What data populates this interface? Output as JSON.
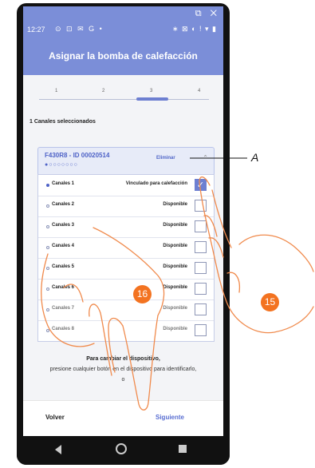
{
  "statusbar": {
    "time": "12:27",
    "icons_left": "⊙ ⊡ ✉ G •",
    "icons_right": "∗ ⊠ ◐ ! ▾ ▮",
    "top_icons": "⧉ ✕"
  },
  "header": {
    "title": "Asignar la bomba de calefacción"
  },
  "stepper": {
    "steps": [
      "1",
      "2",
      "3",
      "4"
    ],
    "active_step": 3
  },
  "selection": {
    "count_label": "1 Canales seleccionados"
  },
  "device": {
    "name": "F430R8 - ID 00020514",
    "dots": "●○○○○○○○",
    "remove_label": "Eliminar",
    "chevron": "⌃"
  },
  "channels": [
    {
      "name": "Canales 1",
      "status": "Vinculado para calefacción",
      "checked": true
    },
    {
      "name": "Canales 2",
      "status": "Disponible",
      "checked": false
    },
    {
      "name": "Canales 3",
      "status": "Disponible",
      "checked": false
    },
    {
      "name": "Canales 4",
      "status": "Disponible",
      "checked": false
    },
    {
      "name": "Canales 5",
      "status": "Disponible",
      "checked": false
    },
    {
      "name": "Canales 6",
      "status": "Disponible",
      "checked": false
    },
    {
      "name": "Canales 7",
      "status": "Disponible",
      "checked": false
    },
    {
      "name": "Canales 8",
      "status": "Disponible",
      "checked": false
    }
  ],
  "info": {
    "line1": "Para cambiar el dispositivo,",
    "line2": "presione cualquier botón en el dispositivo para identificarlo,",
    "line3": "o"
  },
  "footer": {
    "back_label": "Volver",
    "next_label": "Siguiente"
  },
  "annotations": {
    "callout_a": "A",
    "callout_15": "15",
    "callout_16": "16",
    "callout_color": "#f37321"
  },
  "colors": {
    "accent": "#7b8ed8",
    "link": "#5a6fd2"
  }
}
